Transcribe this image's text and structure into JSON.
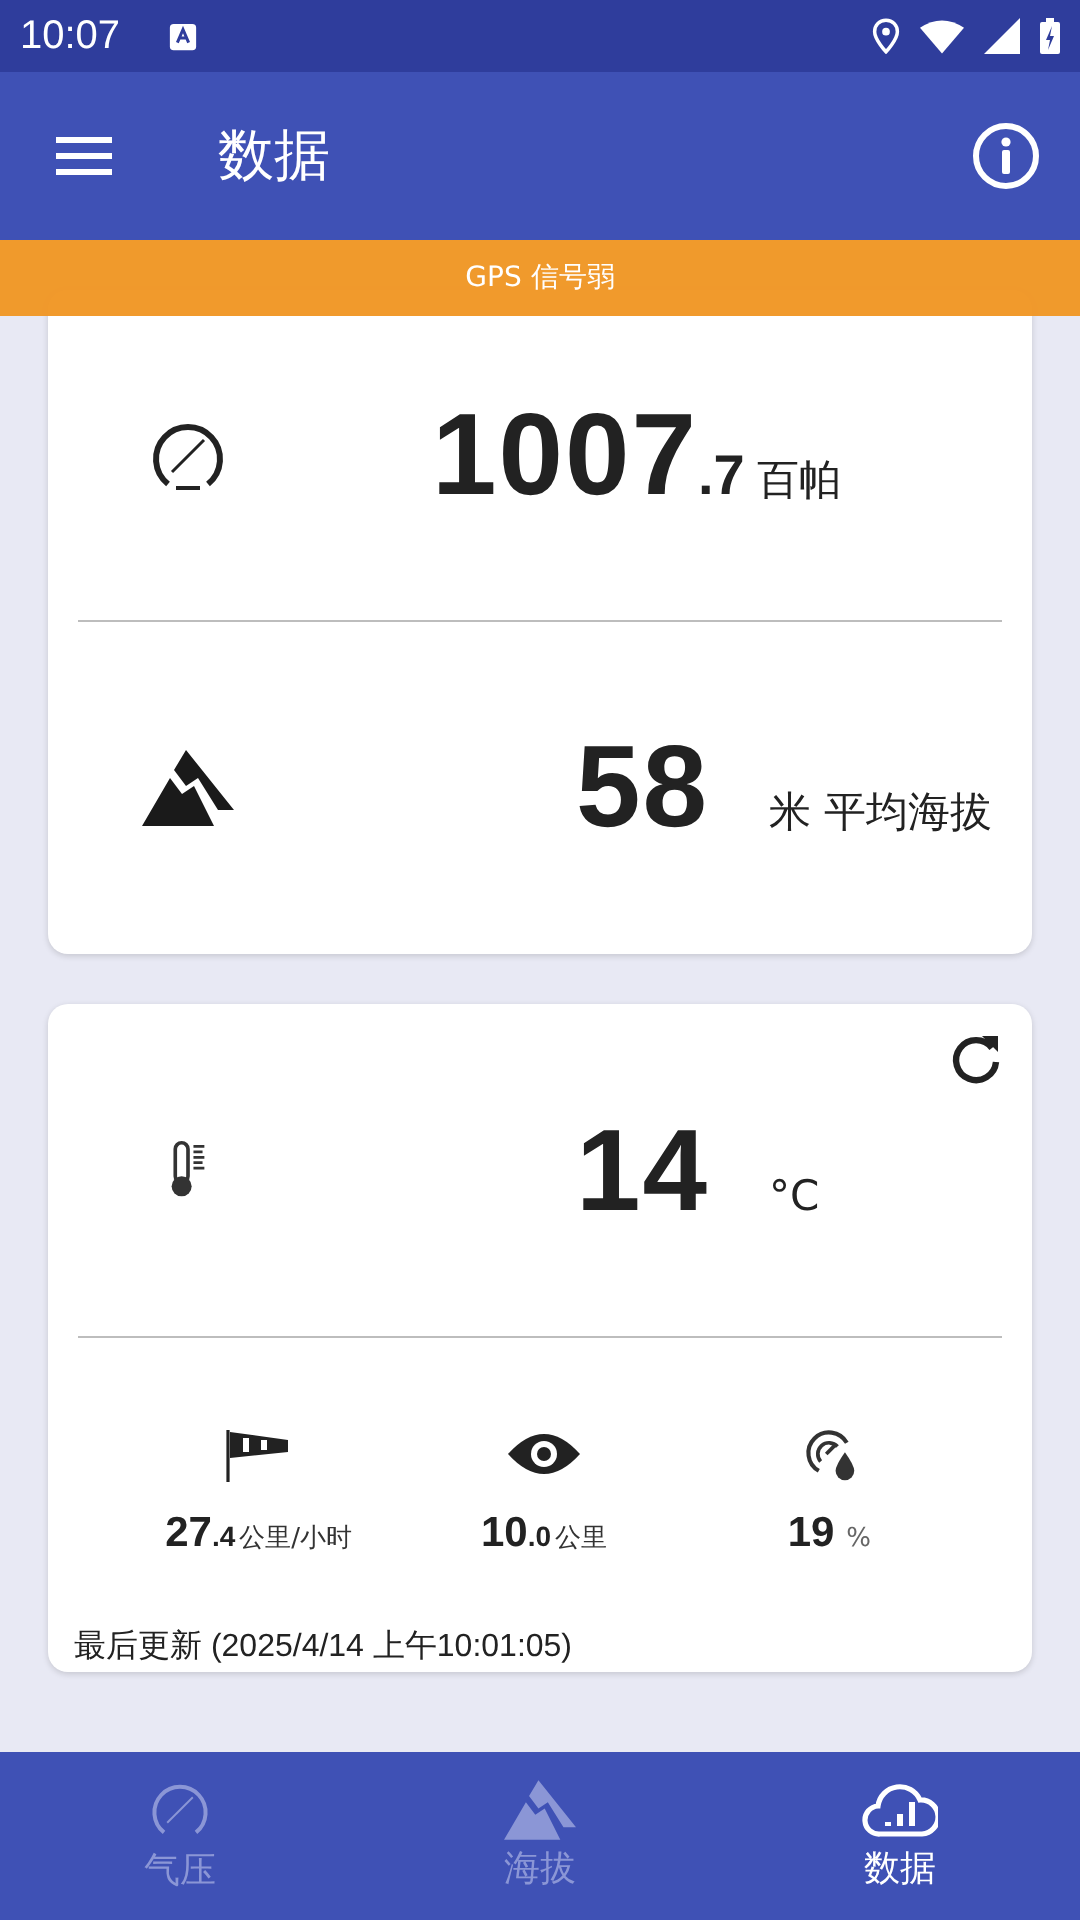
{
  "status_bar": {
    "time": "10:07"
  },
  "app_bar": {
    "title": "数据"
  },
  "banner": {
    "text": "GPS 信号弱"
  },
  "reading_card": {
    "rows": [
      {
        "kind": "pressure",
        "value": "1007",
        "decimal": ".7",
        "unit": "百帕"
      },
      {
        "kind": "altitude",
        "value": "58",
        "unit": "米 平均海拔"
      }
    ]
  },
  "weather_card": {
    "temperature": {
      "value": "14",
      "unit": "°C"
    },
    "metrics": [
      {
        "kind": "wind",
        "value": "27",
        "decimal": ".4",
        "unit": "公里/小时"
      },
      {
        "kind": "visibility",
        "value": "10",
        "decimal": ".0",
        "unit": "公里"
      },
      {
        "kind": "humidity",
        "value": "19",
        "unit": "%"
      }
    ],
    "updated": "最后更新 (2025/4/14 上午10:01:05)"
  },
  "bottom_nav": [
    {
      "kind": "pressure",
      "label": "气压",
      "selected": false
    },
    {
      "kind": "altitude",
      "label": "海拔",
      "selected": false
    },
    {
      "kind": "data",
      "label": "数据",
      "selected": true
    }
  ]
}
